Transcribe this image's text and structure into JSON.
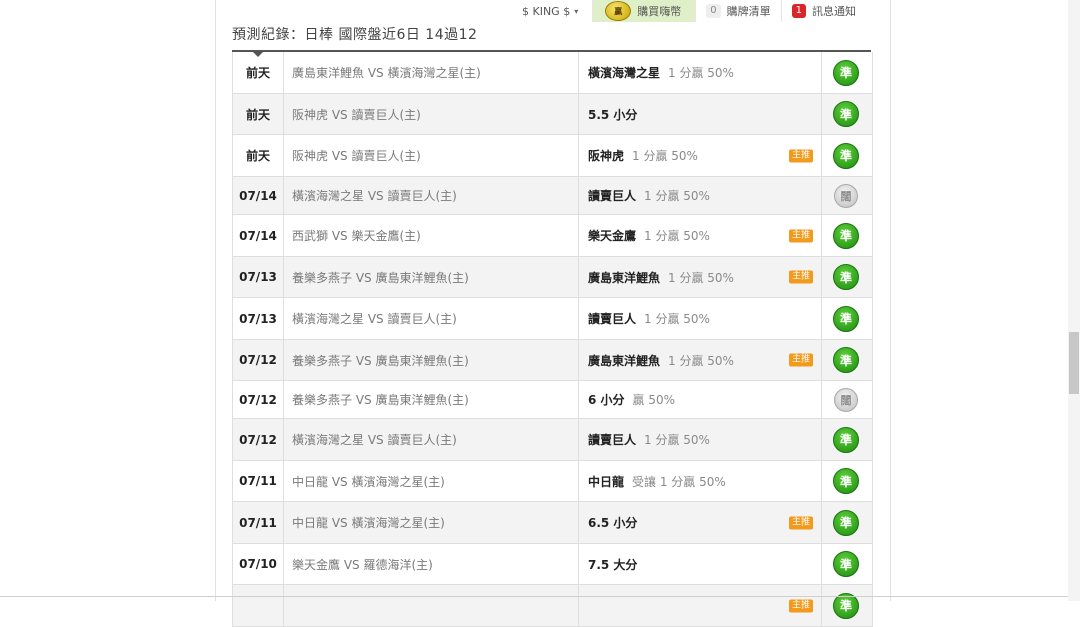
{
  "topbar": {
    "user_label": "$ KING $",
    "caret": "▾",
    "coin_label": "贏",
    "buy_label": "購買嗨幣",
    "cart_count": "0",
    "cart_label": "購牌清單",
    "notify_count": "1",
    "notify_label": "訊息通知"
  },
  "heading": "預測紀錄：日棒 國際盤近6日 14過12",
  "records": [
    {
      "date": "前天",
      "match": "廣島東洋鯉魚 VS 橫濱海灣之星(主)",
      "pick": "橫濱海灣之星",
      "detail": "1 分贏 50%",
      "tag": "",
      "result": "準",
      "win": true
    },
    {
      "date": "前天",
      "match": "阪神虎 VS 讀賣巨人(主)",
      "pick": "5.5 小分",
      "detail": "",
      "tag": "",
      "result": "準",
      "win": true
    },
    {
      "date": "前天",
      "match": "阪神虎 VS 讀賣巨人(主)",
      "pick": "阪神虎",
      "detail": "1 分贏 50%",
      "tag": "主推",
      "result": "準",
      "win": true
    },
    {
      "date": "07/14",
      "match": "橫濱海灣之星 VS 讀賣巨人(主)",
      "pick": "讀賣巨人",
      "detail": "1 分贏 50%",
      "tag": "",
      "result": "闊",
      "win": false
    },
    {
      "date": "07/14",
      "match": "西武獅 VS 樂天金鷹(主)",
      "pick": "樂天金鷹",
      "detail": "1 分贏 50%",
      "tag": "主推",
      "result": "準",
      "win": true
    },
    {
      "date": "07/13",
      "match": "養樂多燕子 VS 廣島東洋鯉魚(主)",
      "pick": "廣島東洋鯉魚",
      "detail": "1 分贏 50%",
      "tag": "主推",
      "result": "準",
      "win": true
    },
    {
      "date": "07/13",
      "match": "橫濱海灣之星 VS 讀賣巨人(主)",
      "pick": "讀賣巨人",
      "detail": "1 分贏 50%",
      "tag": "",
      "result": "準",
      "win": true
    },
    {
      "date": "07/12",
      "match": "養樂多燕子 VS 廣島東洋鯉魚(主)",
      "pick": "廣島東洋鯉魚",
      "detail": "1 分贏 50%",
      "tag": "主推",
      "result": "準",
      "win": true
    },
    {
      "date": "07/12",
      "match": "養樂多燕子 VS 廣島東洋鯉魚(主)",
      "pick": "6 小分",
      "detail": "贏 50%",
      "tag": "",
      "result": "闊",
      "win": false
    },
    {
      "date": "07/12",
      "match": "橫濱海灣之星 VS 讀賣巨人(主)",
      "pick": "讀賣巨人",
      "detail": "1 分贏 50%",
      "tag": "",
      "result": "準",
      "win": true
    },
    {
      "date": "07/11",
      "match": "中日龍 VS 橫濱海灣之星(主)",
      "pick": "中日龍",
      "detail": "受讓 1 分贏 50%",
      "tag": "",
      "result": "準",
      "win": true
    },
    {
      "date": "07/11",
      "match": "中日龍 VS 橫濱海灣之星(主)",
      "pick": "6.5 小分",
      "detail": "",
      "tag": "主推",
      "result": "準",
      "win": true
    },
    {
      "date": "07/10",
      "match": "樂天金鷹 VS 羅德海洋(主)",
      "pick": "7.5 大分",
      "detail": "",
      "tag": "",
      "result": "準",
      "win": true
    },
    {
      "date": "",
      "match": "",
      "pick": "",
      "detail": "",
      "tag": "主推",
      "result": "準",
      "win": true
    }
  ]
}
